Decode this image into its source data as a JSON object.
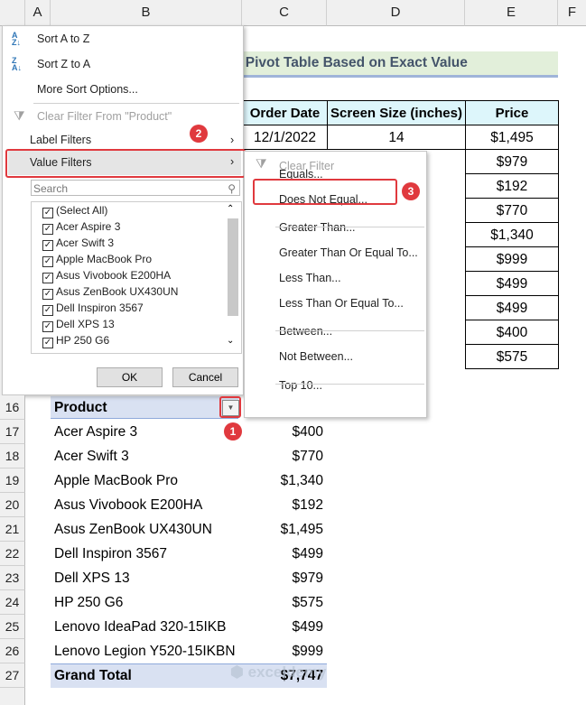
{
  "columns": [
    "A",
    "B",
    "C",
    "D",
    "E",
    "F"
  ],
  "rows": [
    "16",
    "17",
    "18",
    "19",
    "20",
    "21",
    "22",
    "23",
    "24",
    "25",
    "26",
    "27"
  ],
  "title": "n Pivot Table Based on Exact Value",
  "table": {
    "headers": [
      "Order Date",
      "Screen Size (inches)",
      "Price"
    ],
    "first_row": {
      "date": "12/1/2022",
      "size": "14"
    },
    "prices": [
      "$1,495",
      "$979",
      "$192",
      "$770",
      "$1,340",
      "$999",
      "$499",
      "$499",
      "$400",
      "$575"
    ]
  },
  "pivot": {
    "header": "Product",
    "items": [
      {
        "name": "Acer Aspire 3",
        "value": "$400"
      },
      {
        "name": "Acer Swift 3",
        "value": "$770"
      },
      {
        "name": "Apple MacBook Pro",
        "value": "$1,340"
      },
      {
        "name": "Asus Vivobook E200HA",
        "value": "$192"
      },
      {
        "name": "Asus ZenBook UX430UN",
        "value": "$1,495"
      },
      {
        "name": "Dell Inspiron 3567",
        "value": "$499"
      },
      {
        "name": "Dell XPS 13",
        "value": "$979"
      },
      {
        "name": "HP 250 G6",
        "value": "$575"
      },
      {
        "name": "Lenovo IdeaPad 320-15IKB",
        "value": "$499"
      },
      {
        "name": "Lenovo Legion Y520-15IKBN",
        "value": "$999"
      }
    ],
    "total_label": "Grand Total",
    "total_value": "$7,747"
  },
  "menu": {
    "sort_az": "Sort A to Z",
    "sort_za": "Sort Z to A",
    "more_sort": "More Sort Options...",
    "clear_filter": "Clear Filter From \"Product\"",
    "label_filters": "Label Filters",
    "value_filters": "Value Filters",
    "search_placeholder": "Search",
    "list": [
      "(Select All)",
      "Acer Aspire 3",
      "Acer Swift 3",
      "Apple MacBook Pro",
      "Asus Vivobook E200HA",
      "Asus ZenBook UX430UN",
      "Dell Inspiron 3567",
      "Dell XPS 13",
      "HP 250 G6"
    ],
    "ok": "OK",
    "cancel": "Cancel"
  },
  "submenu": {
    "clear": "Clear Filter",
    "items": [
      "Equals...",
      "Does Not Equal...",
      "Greater Than...",
      "Greater Than Or Equal To...",
      "Less Than...",
      "Less Than Or Equal To...",
      "Between...",
      "Not Between...",
      "Top 10..."
    ]
  },
  "badges": [
    "1",
    "2",
    "3"
  ],
  "watermark": "exceldemy EXCEL · DATA · BI",
  "colors": {
    "accent": "#e0393e",
    "title_bg": "#e2efda",
    "header_bg": "#ddf6fb",
    "pivot_bg": "#d9e1f2"
  }
}
